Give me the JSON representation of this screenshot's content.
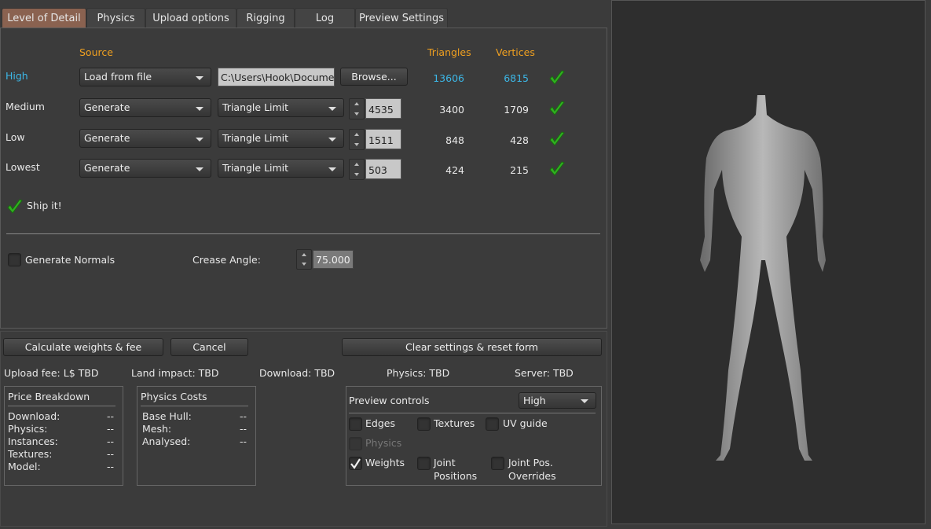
{
  "tabs": [
    "Level of Detail",
    "Physics",
    "Upload options",
    "Rigging",
    "Log",
    "Preview Settings"
  ],
  "lod": {
    "headers": {
      "source": "Source",
      "triangles": "Triangles",
      "vertices": "Vertices"
    },
    "rows": [
      {
        "label": "High",
        "source": "Load from file",
        "file": "C:\\Users\\Hook\\Documents",
        "browse": "Browse...",
        "triangles": "13606",
        "vertices": "6815",
        "ok": true
      },
      {
        "label": "Medium",
        "source": "Generate",
        "mode": "Triangle Limit",
        "limit": "4535",
        "triangles": "3400",
        "vertices": "1709",
        "ok": true
      },
      {
        "label": "Low",
        "source": "Generate",
        "mode": "Triangle Limit",
        "limit": "1511",
        "triangles": "848",
        "vertices": "428",
        "ok": true
      },
      {
        "label": "Lowest",
        "source": "Generate",
        "mode": "Triangle Limit",
        "limit": "503",
        "triangles": "424",
        "vertices": "215",
        "ok": true
      }
    ],
    "ship_it": "Ship it!",
    "generate_normals": "Generate Normals",
    "generate_normals_checked": false,
    "crease_angle_label": "Crease Angle:",
    "crease_angle": "75.000"
  },
  "buttons": {
    "calculate": "Calculate weights & fee",
    "cancel": "Cancel",
    "clear": "Clear settings & reset form"
  },
  "status": {
    "upload_fee": "Upload fee: L$ TBD",
    "land_impact": "Land impact: TBD",
    "download": "Download: TBD",
    "physics": "Physics: TBD",
    "server": "Server: TBD"
  },
  "price": {
    "title": "Price Breakdown",
    "rows": [
      [
        "Download:",
        "--"
      ],
      [
        "Physics:",
        "--"
      ],
      [
        "Instances:",
        "--"
      ],
      [
        "Textures:",
        "--"
      ],
      [
        "Model:",
        "--"
      ]
    ]
  },
  "physics_costs": {
    "title": "Physics Costs",
    "rows": [
      [
        "Base Hull:",
        "--"
      ],
      [
        "Mesh:",
        "--"
      ],
      [
        "Analysed:",
        "--"
      ]
    ]
  },
  "preview": {
    "title": "Preview controls",
    "lod": "High",
    "options": {
      "edges": "Edges",
      "textures": "Textures",
      "uv": "UV guide",
      "physics": "Physics",
      "weights": "Weights",
      "joint1": "Joint",
      "joint2": "Positions",
      "jpo1": "Joint Pos.",
      "jpo2": "Overrides"
    },
    "checked": {
      "edges": false,
      "textures": false,
      "uv": false,
      "physics": false,
      "weights": true,
      "joints": false,
      "joint_overrides": false
    }
  },
  "colors": {
    "accent": "#f0a020",
    "link": "#3cb8e8",
    "active_tab": "#8a6250",
    "ok": "#30b020"
  }
}
